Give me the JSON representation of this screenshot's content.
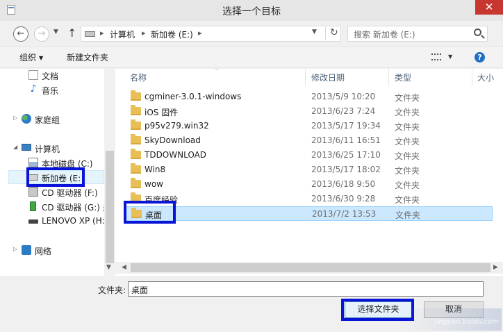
{
  "window": {
    "title": "选择一个目标",
    "close_glyph": "✕"
  },
  "nav": {
    "back_glyph": "←",
    "forward_glyph": "→",
    "history_glyph": "▼",
    "up_glyph": "↑",
    "breadcrumb": [
      "计算机",
      "新加卷 (E:)"
    ],
    "separator": "▸",
    "dropdown_glyph": "▼",
    "refresh_glyph": "↻",
    "search_placeholder": "搜索 新加卷 (E:)"
  },
  "toolbar": {
    "organize_label": "组织",
    "new_folder_label": "新建文件夹",
    "help_glyph": "?"
  },
  "navpane": {
    "items": [
      {
        "label": "文档",
        "icon": "document-icon"
      },
      {
        "label": "音乐",
        "icon": "music-icon"
      },
      {
        "label": "家庭组",
        "icon": "homegroup-icon"
      },
      {
        "label": "计算机",
        "icon": "computer-icon"
      },
      {
        "label": "本地磁盘 (C:)",
        "icon": "local-disk-icon"
      },
      {
        "label": "新加卷 (E:",
        "icon": "drive-icon"
      },
      {
        "label": "CD 驱动器 (F:)",
        "icon": "cd-drive-icon"
      },
      {
        "label": "CD 驱动器 (G:) 关",
        "icon": "cd-drive-green-icon"
      },
      {
        "label": "LENOVO XP (H:",
        "icon": "lenovo-drive-icon"
      },
      {
        "label": "网络",
        "icon": "network-icon"
      }
    ],
    "selected_index": 5,
    "scroll_down_glyph": "▼"
  },
  "filelist": {
    "columns": [
      "名称",
      "修改日期",
      "类型",
      "大小"
    ],
    "sort_glyph": "^",
    "rows": [
      {
        "name": "cgminer-3.0.1-windows",
        "date": "2013/5/9 10:20",
        "type": "文件夹"
      },
      {
        "name": "iOS 固件",
        "date": "2013/6/23 7:24",
        "type": "文件夹"
      },
      {
        "name": "p95v279.win32",
        "date": "2013/5/17 19:34",
        "type": "文件夹"
      },
      {
        "name": "SkyDownload",
        "date": "2013/6/11 16:51",
        "type": "文件夹"
      },
      {
        "name": "TDDOWNLOAD",
        "date": "2013/6/25 17:10",
        "type": "文件夹"
      },
      {
        "name": "Win8",
        "date": "2013/5/17 18:02",
        "type": "文件夹"
      },
      {
        "name": "wow",
        "date": "2013/6/18 9:50",
        "type": "文件夹"
      },
      {
        "name": "百度经验",
        "date": "2013/6/30 9:28",
        "type": "文件夹"
      },
      {
        "name": "桌面",
        "date": "2013/7/2 13:53",
        "type": "文件夹"
      }
    ],
    "selected_index": 8,
    "scroll_left_glyph": "◀",
    "scroll_right_glyph": "▶"
  },
  "bottom": {
    "filename_label": "文件夹:",
    "filename_value": "桌面",
    "select_button": "选择文件夹",
    "cancel_button": "取消"
  },
  "watermark": "jingyan.baidu.com",
  "colors": {
    "annotation": "#0a14d6",
    "selection": "#cce8ff",
    "close": "#c7372f"
  }
}
